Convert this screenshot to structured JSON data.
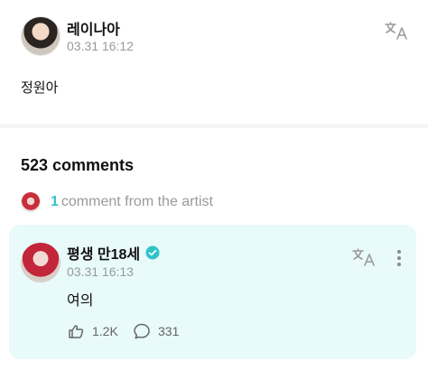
{
  "post": {
    "author": "레이나아",
    "timestamp": "03.31 16:12",
    "body": "정원아"
  },
  "comments": {
    "count_label": "523 comments",
    "artist_count": "1",
    "artist_text": "comment from the artist"
  },
  "artist_comment": {
    "author": "평생 만18세",
    "timestamp": "03.31 16:13",
    "body": "여의",
    "likes": "1.2K",
    "replies": "331"
  },
  "colors": {
    "accent": "#2fc4c9",
    "card_bg": "#e8faf9",
    "muted_text": "#9a9a9a"
  },
  "icons": [
    "translate-icon",
    "verified-badge-icon",
    "more-options-icon",
    "like-icon",
    "reply-icon"
  ]
}
